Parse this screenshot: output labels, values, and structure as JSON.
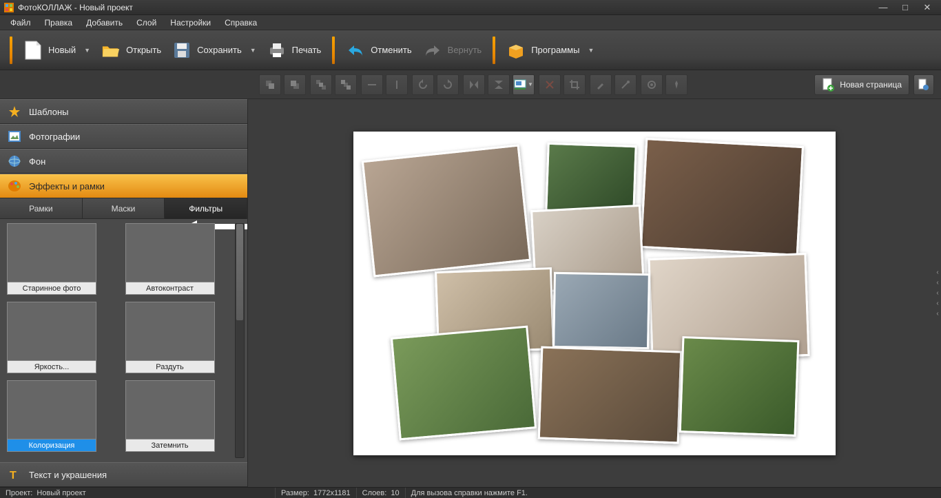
{
  "title": "ФотоКОЛЛАЖ - Новый проект",
  "menu": [
    "Файл",
    "Правка",
    "Добавить",
    "Слой",
    "Настройки",
    "Справка"
  ],
  "toolbar": {
    "new": "Новый",
    "open": "Открыть",
    "save": "Сохранить",
    "print": "Печать",
    "undo": "Отменить",
    "redo": "Вернуть",
    "programs": "Программы"
  },
  "subbar": {
    "new_page": "Новая страница"
  },
  "sidebar": {
    "items": [
      {
        "label": "Шаблоны"
      },
      {
        "label": "Фотографии"
      },
      {
        "label": "Фон"
      },
      {
        "label": "Эффекты и рамки",
        "active": true
      },
      {
        "label": "Текст и украшения"
      }
    ],
    "tabs": [
      "Рамки",
      "Маски",
      "Фильтры"
    ],
    "active_tab": 2,
    "filters": [
      {
        "label": "Старинное фото",
        "cls": "sepia"
      },
      {
        "label": "Автоконтраст",
        "cls": "normal"
      },
      {
        "label": "Яркость...",
        "cls": "bright"
      },
      {
        "label": "Раздуть",
        "cls": "expand"
      },
      {
        "label": "Колоризация",
        "cls": "colorize",
        "selected": true
      },
      {
        "label": "Затемнить",
        "cls": "darken"
      }
    ]
  },
  "status": {
    "project_label": "Проект:",
    "project_name": "Новый проект",
    "size_label": "Размер:",
    "size_value": "1772x1181",
    "layers_label": "Слоев:",
    "layers_value": "10",
    "hint": "Для вызова справки нажмите F1."
  }
}
